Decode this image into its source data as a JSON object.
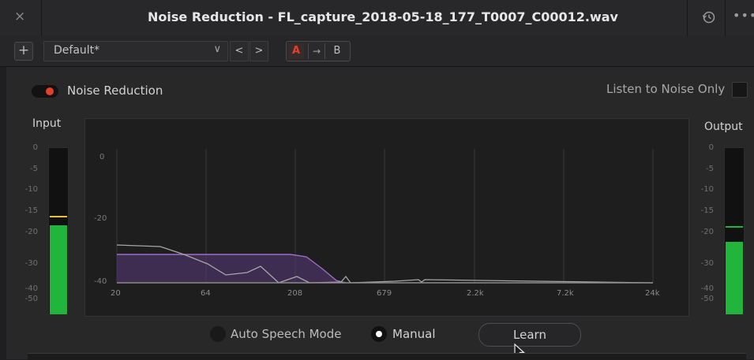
{
  "window": {
    "title": "Noise Reduction - FL_capture_2018-05-18_177_T0007_C00012.wav",
    "close_glyph": "×",
    "more_glyph": "•••"
  },
  "toolbar": {
    "add_glyph": "+",
    "preset_value": "Default*",
    "dropdown_glyph": "∨",
    "prev_glyph": "<",
    "next_glyph": ">",
    "a_label": "A",
    "copy_glyph": "→",
    "b_label": "B"
  },
  "controls": {
    "noise_reduction_label": "Noise Reduction",
    "noise_reduction_on": true,
    "listen_label": "Listen to Noise Only",
    "listen_checked": false
  },
  "meters": {
    "input_label": "Input",
    "output_label": "Output",
    "scale_labels": [
      "0",
      "-5",
      "-10",
      "-15",
      "-20",
      "-30",
      "-40",
      "-50"
    ],
    "input_level_db": -18,
    "input_peak_db": -16,
    "output_level_db": -23,
    "output_peak_db": -19
  },
  "graph": {
    "y_labels": [
      "0",
      "-20",
      "-40"
    ],
    "x_labels": [
      "20",
      "64",
      "208",
      "679",
      "2.2k",
      "7.2k",
      "24k"
    ]
  },
  "modes": {
    "auto_label": "Auto Speech Mode",
    "manual_label": "Manual",
    "selected": "Manual",
    "learn_label": "Learn"
  },
  "colors": {
    "accent_red": "#e3402e",
    "meter_green": "#22b53c",
    "peak_yellow": "#e9c23a",
    "profile_purple": "#9b6fc2"
  }
}
